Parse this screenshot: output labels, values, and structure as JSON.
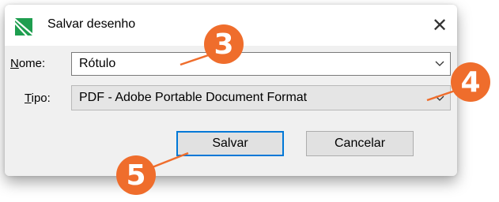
{
  "window": {
    "title": "Salvar desenho",
    "close_icon": "close-icon",
    "app_icon": "cutting-app-icon"
  },
  "form": {
    "name_label_accel": "N",
    "name_label_rest": "ome:",
    "name_value": "Rótulo",
    "type_label_accel": "T",
    "type_label_rest": "ipo:",
    "type_value": "PDF - Adobe Portable Document Format"
  },
  "buttons": {
    "save": "Salvar",
    "cancel": "Cancelar"
  },
  "callouts": {
    "name": "3",
    "type": "4",
    "save": "5"
  },
  "colors": {
    "badge": "#ef6d2c",
    "focus_border": "#0078d7",
    "app_icon_green": "#1e9e4f"
  }
}
